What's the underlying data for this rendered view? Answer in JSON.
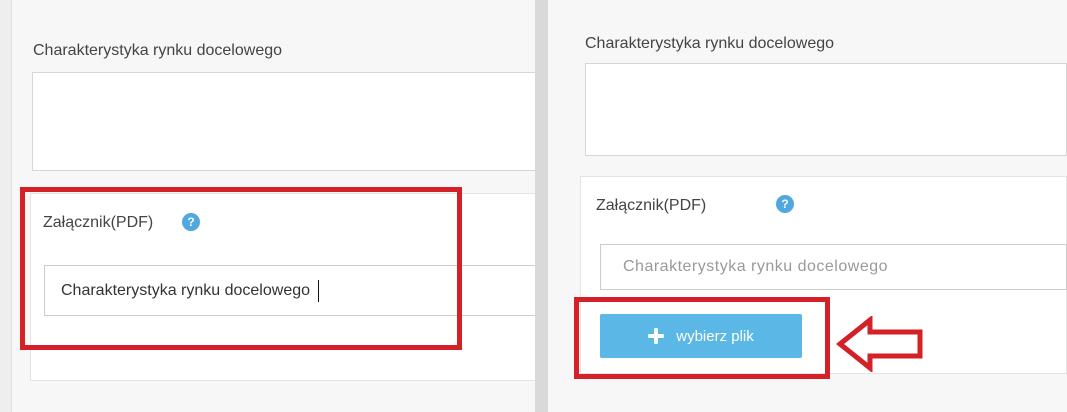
{
  "left": {
    "section_label": "Charakterystyka rynku docelowego",
    "attachment_label": "Załącznik(PDF)",
    "help_glyph": "?",
    "input_value": "Charakterystyka rynku docelowego"
  },
  "right": {
    "section_label": "Charakterystyka rynku docelowego",
    "attachment_label": "Załącznik(PDF)",
    "help_glyph": "?",
    "input_placeholder": "Charakterystyka rynku docelowego",
    "upload_button_label": "wybierz plik"
  },
  "colors": {
    "highlight": "#d42027",
    "button": "#5bb7e6",
    "help_icon": "#4fa8de"
  },
  "icons": [
    "help-icon",
    "plus-icon",
    "left-arrow-icon"
  ]
}
